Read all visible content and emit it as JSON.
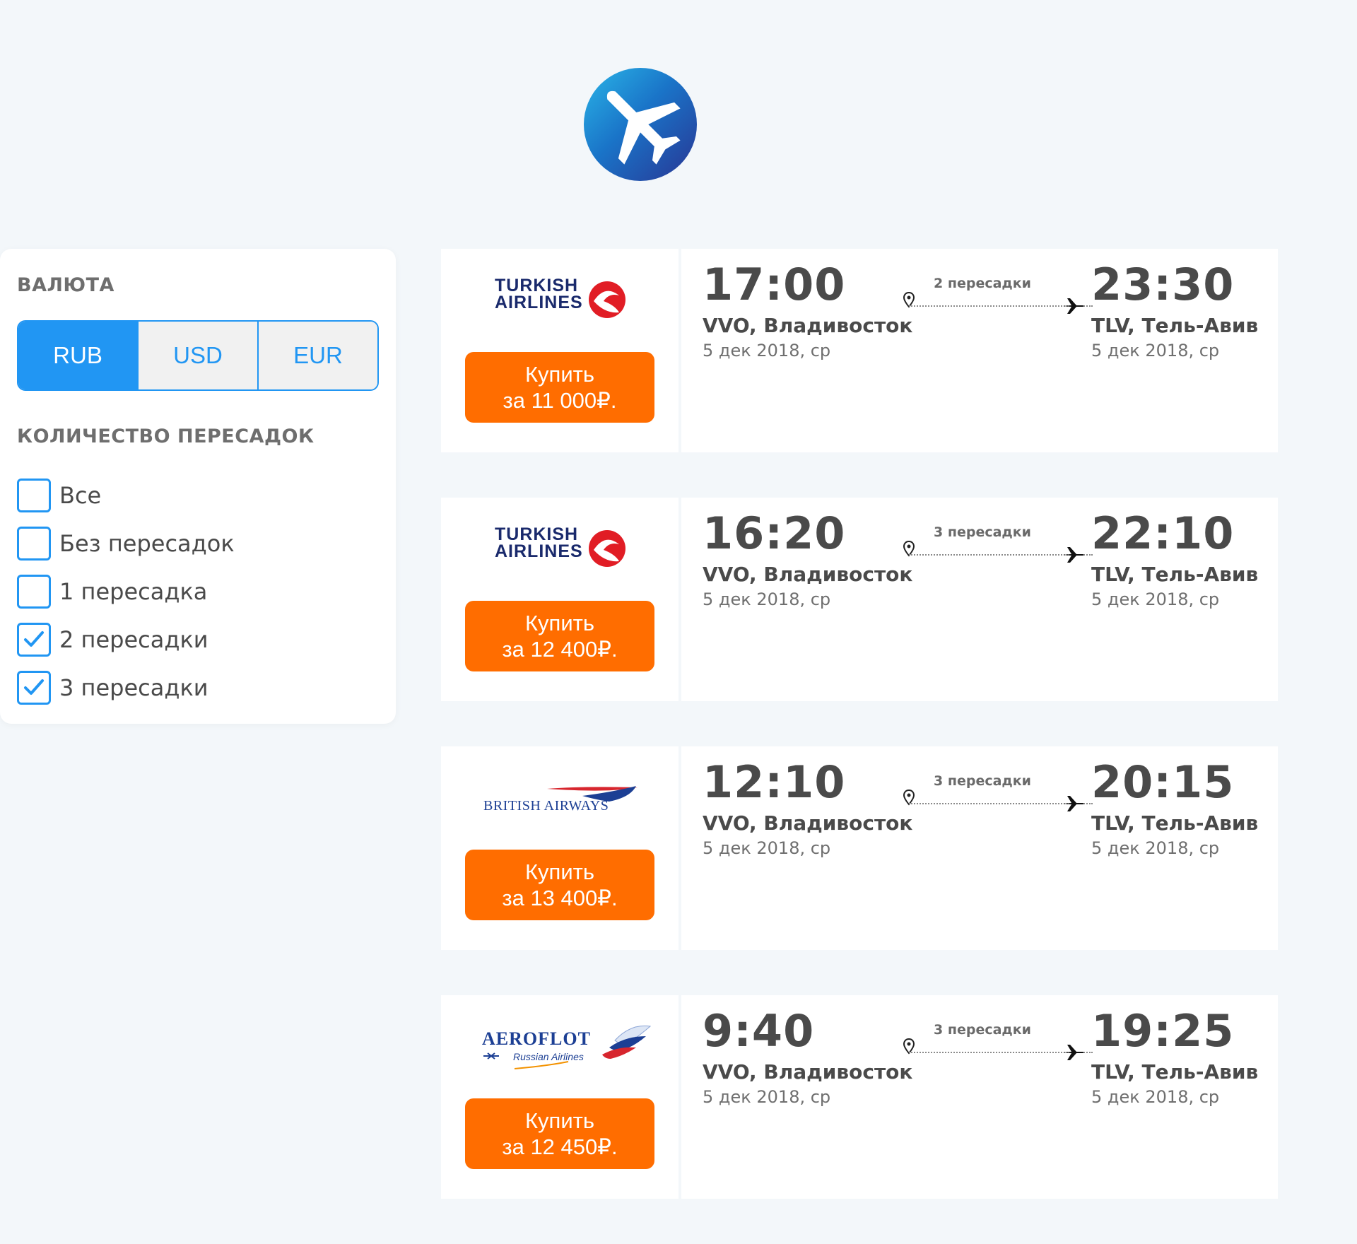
{
  "app": {
    "logo_icon": "airplane-icon",
    "logo_gradient": [
      "#2ab6e8",
      "#1a74c8",
      "#283593"
    ]
  },
  "filter": {
    "currency_heading": "ВАЛЮТА",
    "currencies": [
      {
        "label": "RUB",
        "active": true
      },
      {
        "label": "USD",
        "active": false
      },
      {
        "label": "EUR",
        "active": false
      }
    ],
    "stops_heading": "КОЛИЧЕСТВО ПЕРЕСАДОК",
    "stop_options": [
      {
        "label": "Все",
        "checked": false
      },
      {
        "label": "Без пересадок",
        "checked": false
      },
      {
        "label": "1 пересадка",
        "checked": false
      },
      {
        "label": "2 пересадки",
        "checked": true
      },
      {
        "label": "3 пересадки",
        "checked": true
      }
    ]
  },
  "tickets": [
    {
      "airline": "turkish",
      "logo_text": [
        "TURKISH",
        "AIRLINES"
      ],
      "buy_line1": "Купить",
      "buy_line2": "за 11 000₽.",
      "dep_time": "17:00",
      "dep_city": "VVO, Владивосток",
      "dep_date": "5 дек 2018, ср",
      "stops": "2 пересадки",
      "arr_time": "23:30",
      "arr_city": "TLV, Тель-Авив",
      "arr_date": "5 дек 2018, ср"
    },
    {
      "airline": "turkish",
      "logo_text": [
        "TURKISH",
        "AIRLINES"
      ],
      "buy_line1": "Купить",
      "buy_line2": "за 12 400₽.",
      "dep_time": "16:20",
      "dep_city": "VVO, Владивосток",
      "dep_date": "5 дек 2018, ср",
      "stops": "3 пересадки",
      "arr_time": "22:10",
      "arr_city": "TLV, Тель-Авив",
      "arr_date": "5 дек 2018, ср"
    },
    {
      "airline": "british",
      "logo_text": [
        "BRITISH AIRWAYS"
      ],
      "buy_line1": "Купить",
      "buy_line2": "за 13 400₽.",
      "dep_time": "12:10",
      "dep_city": "VVO, Владивосток",
      "dep_date": "5 дек 2018, ср",
      "stops": "3 пересадки",
      "arr_time": "20:15",
      "arr_city": "TLV, Тель-Авив",
      "arr_date": "5 дек 2018, ср"
    },
    {
      "airline": "aeroflot",
      "logo_text": [
        "AEROFLOT",
        "Russian Airlines"
      ],
      "buy_line1": "Купить",
      "buy_line2": "за 12 450₽.",
      "dep_time": "9:40",
      "dep_city": "VVO, Владивосток",
      "dep_date": "5 дек 2018, ср",
      "stops": "3 пересадки",
      "arr_time": "19:25",
      "arr_city": "TLV, Тель-Авив",
      "arr_date": "5 дек 2018, ср"
    }
  ],
  "colors": {
    "accent": "#2196f3",
    "buy_button": "#ff6d00",
    "background": "#f3f7fa"
  }
}
